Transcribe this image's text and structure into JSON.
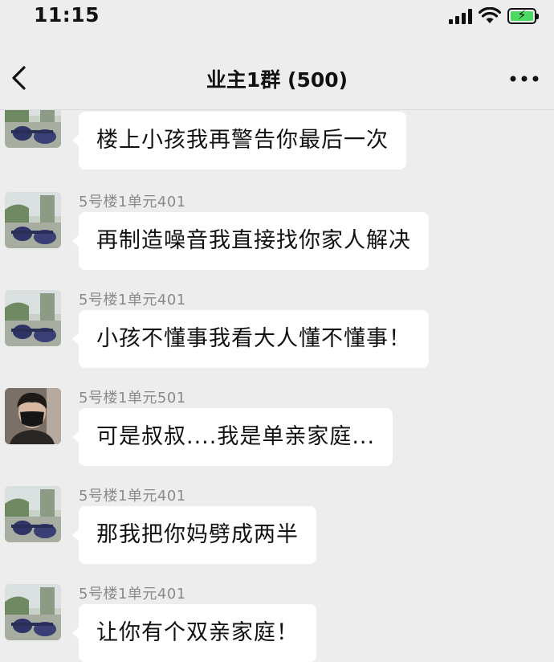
{
  "status_bar": {
    "time": "11:15"
  },
  "nav": {
    "title": "业主1群 (500)"
  },
  "messages": [
    {
      "sender": "",
      "text": "楼上小孩我再警告你最后一次",
      "avatar": "landscape-avatar"
    },
    {
      "sender": "5号楼1单元401",
      "text": "再制造噪音我直接找你家人解决",
      "avatar": "landscape-avatar"
    },
    {
      "sender": "5号楼1单元401",
      "text": "小孩不懂事我看大人懂不懂事！",
      "avatar": "landscape-avatar"
    },
    {
      "sender": "5号楼1单元501",
      "text": "可是叔叔....我是单亲家庭...",
      "avatar": "person-mask-avatar"
    },
    {
      "sender": "5号楼1单元401",
      "text": "那我把你妈劈成两半",
      "avatar": "landscape-avatar"
    },
    {
      "sender": "5号楼1单元401",
      "text": "让你有个双亲家庭！",
      "avatar": "landscape-avatar"
    }
  ],
  "colors": {
    "background": "#ededed",
    "bubble": "#ffffff",
    "sender_text": "#8a8a8a",
    "battery": "#4cd964"
  }
}
